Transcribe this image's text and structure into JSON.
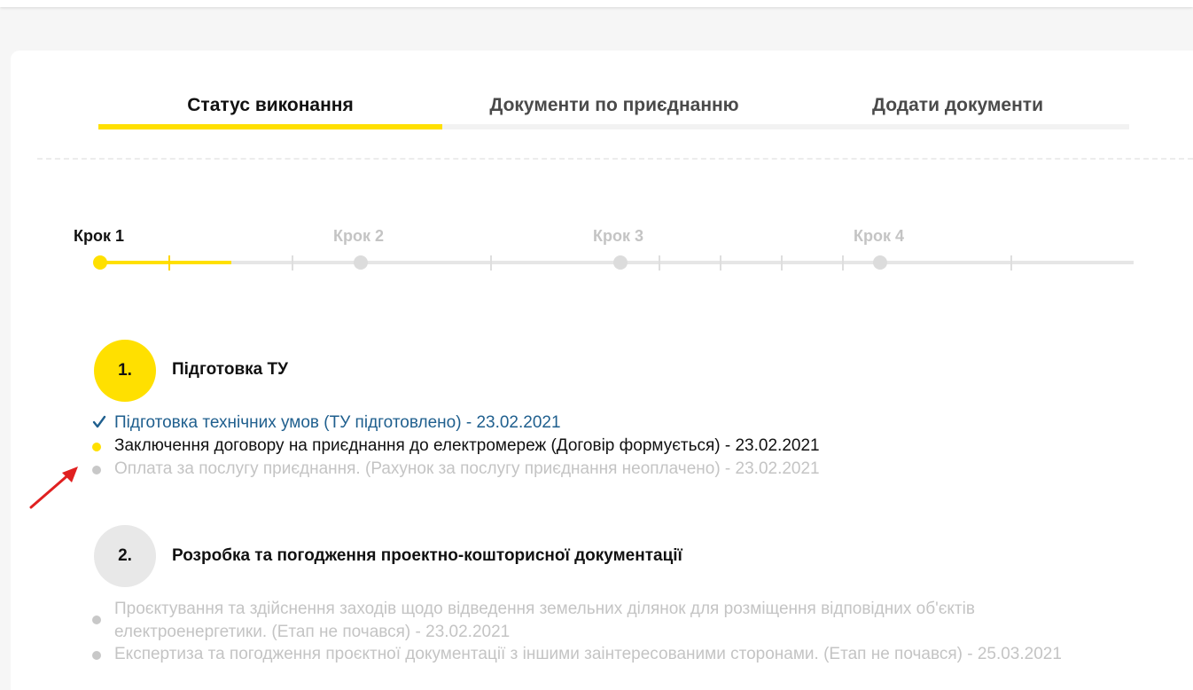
{
  "tabs": [
    {
      "label": "Статус виконання",
      "active": true
    },
    {
      "label": "Документи по приєднанню",
      "active": false
    },
    {
      "label": "Додати документи",
      "active": false
    }
  ],
  "stepper": {
    "steps": [
      "Крок 1",
      "Крок 2",
      "Крок 3",
      "Крок 4"
    ],
    "current_step": 1
  },
  "sections": [
    {
      "number": "1.",
      "title": "Підготовка ТУ",
      "items": [
        {
          "status": "done",
          "text": "Підготовка технічних умов (ТУ підготовлено) - 23.02.2021"
        },
        {
          "status": "current",
          "text": "Заключення договору на приєднання до електромереж (Договір формується) - 23.02.2021"
        },
        {
          "status": "pending",
          "text": "Оплата за послугу приєднання. (Рахунок за послугу приєднання неоплачено) - 23.02.2021"
        }
      ]
    },
    {
      "number": "2.",
      "title": "Розробка та погодження проектно-кошторисної документації",
      "items": [
        {
          "status": "pending",
          "text": "Проєктування та здійснення заходів щодо відведення земельних ділянок для розміщення відповідних об'єктів електроенергетики. (Етап не почався) - 23.02.2021"
        },
        {
          "status": "pending",
          "text": "Експертиза та погодження проєктної документації з іншими заінтересованими сторонами. (Етап не почався) - 25.03.2021"
        }
      ]
    }
  ],
  "colors": {
    "accent": "#ffe000",
    "done_text": "#1f5f8e",
    "pending_text": "#c4c4c4",
    "annotation_arrow": "#e02020"
  }
}
